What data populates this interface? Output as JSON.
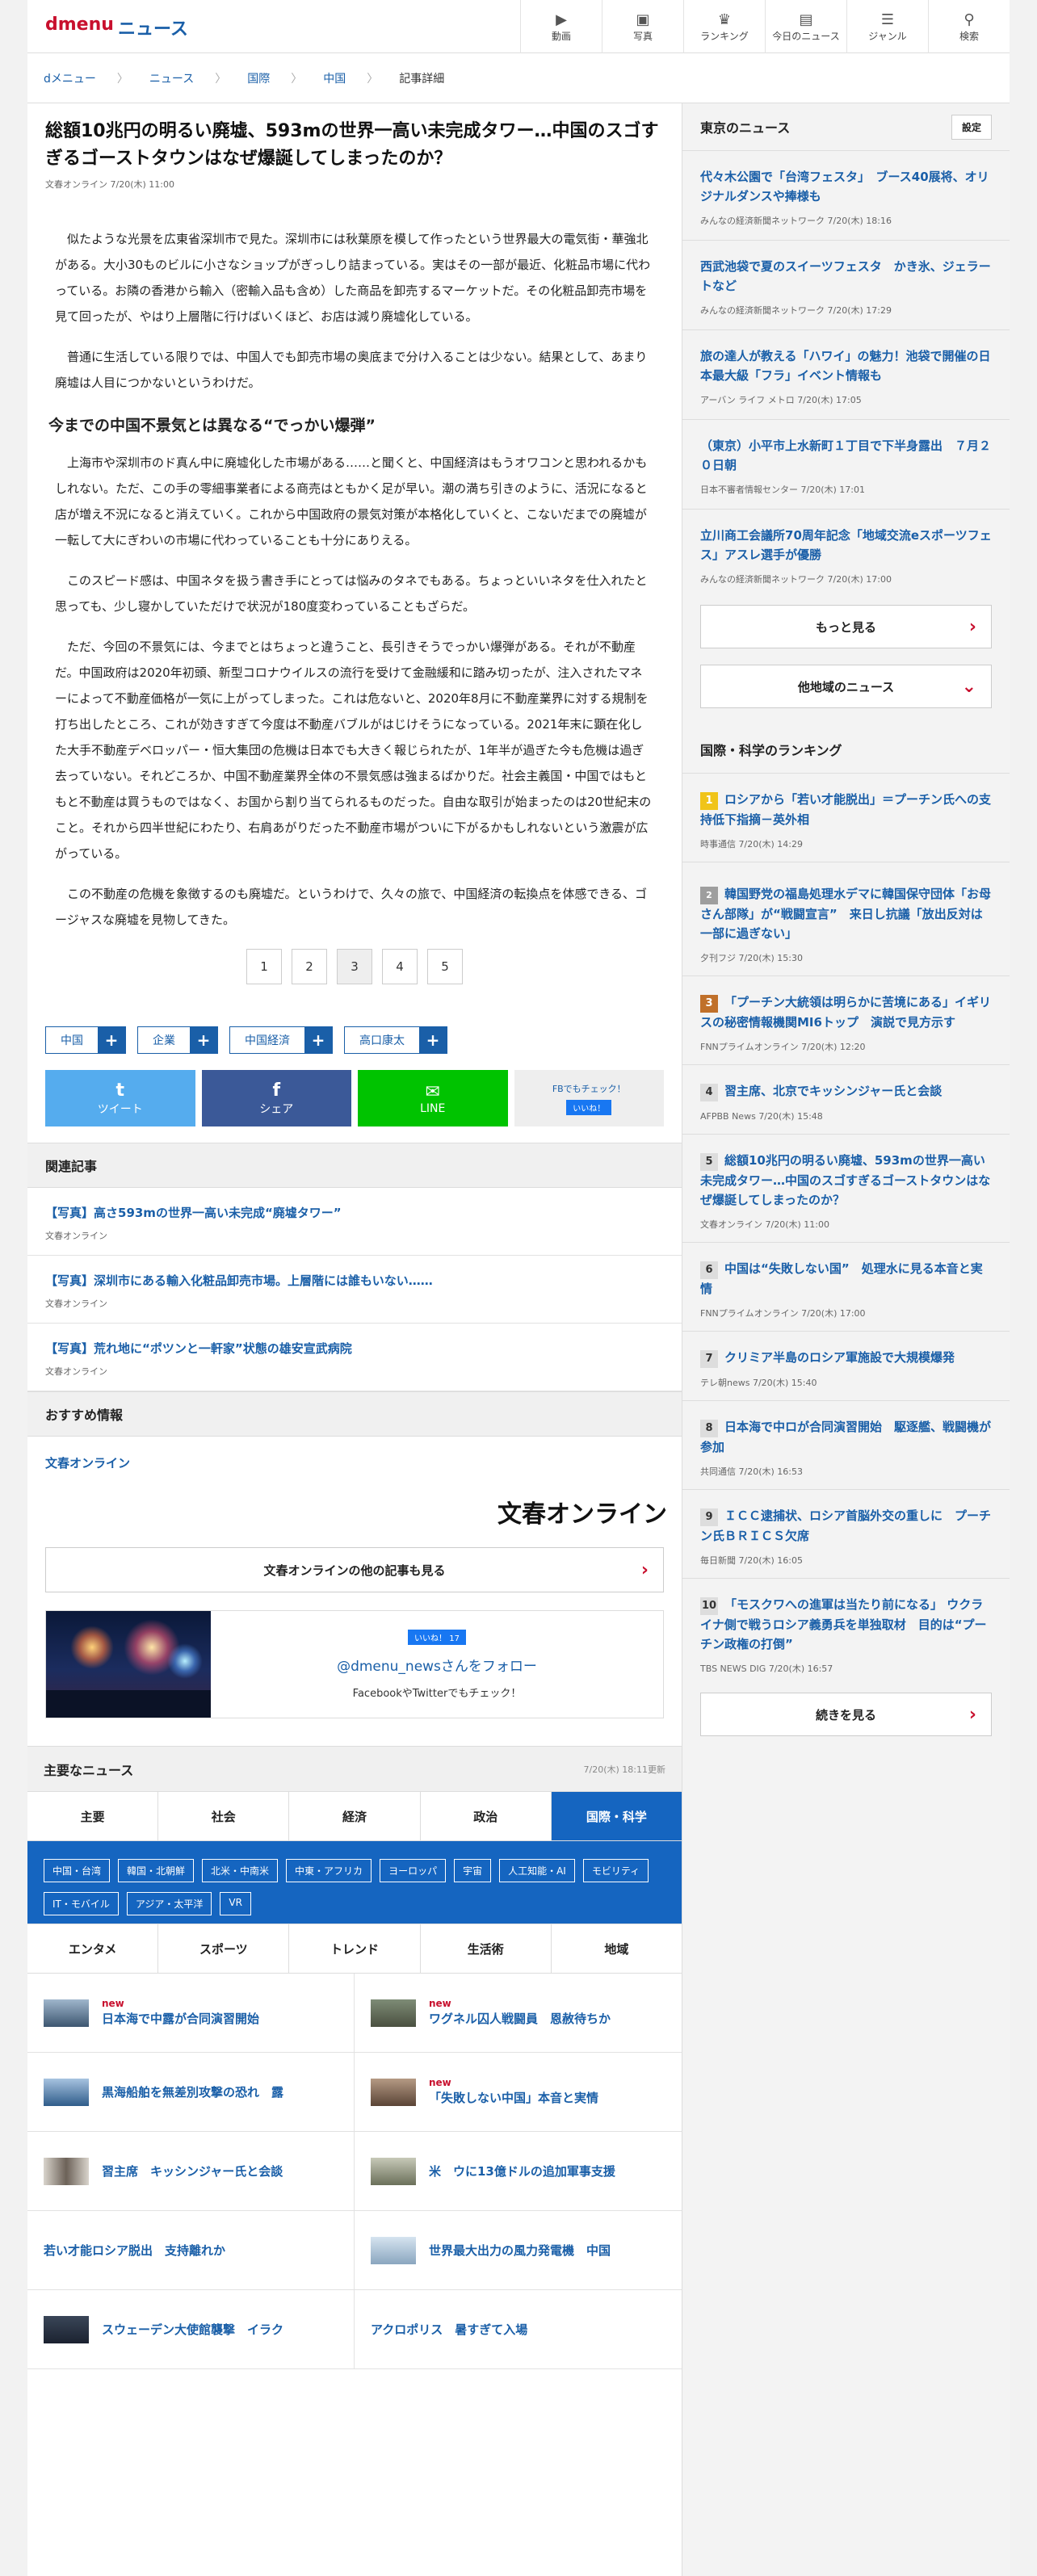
{
  "header": {
    "logo": "dmenu",
    "site_name": "ニュース",
    "nav": [
      {
        "label": "動画",
        "icon": "video-icon"
      },
      {
        "label": "写真",
        "icon": "photo-icon"
      },
      {
        "label": "ランキング",
        "icon": "ranking-icon"
      },
      {
        "label": "今日のニュース",
        "icon": "today-icon"
      },
      {
        "label": "ジャンル",
        "icon": "genre-icon"
      },
      {
        "label": "検索",
        "icon": "search-icon"
      }
    ]
  },
  "breadcrumb": [
    "dメニュー",
    "ニュース",
    "国際",
    "中国",
    "記事詳細"
  ],
  "article": {
    "title": "総額10兆円の明るい廃墟、593mの世界一高い未完成タワー…中国のスゴすぎるゴーストタウンはなぜ爆誕してしまったのか？",
    "source": "文春オンライン",
    "date": "7/20(木) 11:00",
    "p1": "似たような光景を広東省深圳市で見た。深圳市には秋葉原を模して作ったという世界最大の電気街・華強北がある。大小30ものビルに小さなショップがぎっしり詰まっている。実はその一部が最近、化粧品市場に代わっている。お隣の香港から輸入（密輸入品も含め）した商品を卸売するマーケットだ。その化粧品卸売市場を見て回ったが、やはり上層階に行けばいくほど、お店は減り廃墟化している。",
    "p2": "普通に生活している限りでは、中国人でも卸売市場の奥底まで分け入ることは少ない。結果として、あまり廃墟は人目につかないというわけだ。",
    "h2": "今までの中国不景気とは異なる“でっかい爆弾”",
    "p3": "上海市や深圳市のド真ん中に廃墟化した市場がある……と聞くと、中国経済はもうオワコンと思われるかもしれない。ただ、この手の零細事業者による商売はともかく足が早い。潮の満ち引きのように、活況になると店が増え不況になると消えていく。これから中国政府の景気対策が本格化していくと、こないだまでの廃墟が一転して大にぎわいの市場に代わっていることも十分にありえる。",
    "p4": "このスピード感は、中国ネタを扱う書き手にとっては悩みのタネでもある。ちょっといいネタを仕入れたと思っても、少し寝かしていただけで状況が180度変わっていることもざらだ。",
    "p5": "ただ、今回の不景気には、今までとはちょっと違うこと、長引きそうでっかい爆弾がある。それが不動産だ。中国政府は2020年初頭、新型コロナウイルスの流行を受けて金融緩和に踏み切ったが、注入されたマネーによって不動産価格が一気に上がってしまった。これは危ないと、2020年8月に不動産業界に対する規制を打ち出したところ、これが効きすぎて今度は不動産バブルがはじけそうになっている。2021年末に顕在化した大手不動産デベロッパー・恒大集団の危機は日本でも大きく報じられたが、1年半が過ぎた今も危機は過ぎ去っていない。それどころか、中国不動産業界全体の不景気感は強まるばかりだ。社会主義国・中国ではもともと不動産は買うものではなく、お国から割り当てられるものだった。自由な取引が始まったのは20世紀末のこと。それから四半世紀にわたり、右肩あがりだった不動産市場がついに下がるかもしれないという激震が広がっている。",
    "p6": "この不動産の危機を象徴するのも廃墟だ。というわけで、久々の旅で、中国経済の転換点を体感できる、ゴージャスな廃墟を見物してきた。",
    "pages": [
      "1",
      "2",
      "3",
      "4",
      "5"
    ]
  },
  "tags": [
    "中国",
    "企業",
    "中国経済",
    "高口康太"
  ],
  "share": {
    "twitter": "ツイート",
    "facebook": "シェア",
    "line": "LINE",
    "fb_check": "FBでもチェック！",
    "fb_like": "いいね！"
  },
  "related": {
    "heading": "関連記事",
    "items": [
      {
        "title": "【写真】高さ593mの世界一高い未完成“廃墟タワー”",
        "source": "文春オンライン"
      },
      {
        "title": "【写真】深圳市にある輸入化粧品卸売市場。上層階には誰もいない……",
        "source": "文春オンライン"
      },
      {
        "title": "【写真】荒れ地に“ポツンと一軒家”状態の雄安宣武病院",
        "source": "文春オンライン"
      }
    ]
  },
  "recommend": {
    "heading": "おすすめ情報",
    "link": "文春オンライン",
    "logo_text": "文春オンライン",
    "more": "文春オンラインの他の記事も見る",
    "fb_badge": "いいね！ 17",
    "follow": "@dmenu_newsさんをフォロー",
    "follow_sub": "FacebookやTwitterでもチェック！"
  },
  "main_news": {
    "heading": "主要なニュース",
    "updated": "7/20(木) 18:11更新",
    "tabs1": [
      "主要",
      "社会",
      "経済",
      "政治",
      "国際・科学"
    ],
    "subcats": [
      "中国・台湾",
      "韓国・北朝鮮",
      "北米・中南米",
      "中東・アフリカ",
      "ヨーロッパ",
      "宇宙",
      "人工知能・AI",
      "モビリティ",
      "IT・モバイル",
      "アジア・太平洋",
      "VR"
    ],
    "tabs2": [
      "エンタメ",
      "スポーツ",
      "トレンド",
      "生活術",
      "地域"
    ],
    "new_label": "new",
    "items": [
      {
        "title": "日本海で中露が合同演習開始",
        "new": true
      },
      {
        "title": "ワグネル囚人戦闘員　恩赦待ちか",
        "new": true
      },
      {
        "title": "黒海船舶を無差別攻撃の恐れ　露",
        "new": false
      },
      {
        "title": "「失敗しない中国」本音と実情",
        "new": true
      },
      {
        "title": "習主席　キッシンジャー氏と会談",
        "new": false
      },
      {
        "title": "米　ウに13億ドルの追加軍事支援",
        "new": false
      },
      {
        "title": "若い才能ロシア脱出　支持離れか",
        "new": false
      },
      {
        "title": "世界最大出力の風力発電機　中国",
        "new": false
      },
      {
        "title": "スウェーデン大使館襲撃　イラク",
        "new": false
      },
      {
        "title": "アクロポリス　暑すぎて入場",
        "new": false
      }
    ]
  },
  "sidebar": {
    "tokyo": {
      "heading": "東京のニュース",
      "settings": "設定",
      "items": [
        {
          "title": "代々木公園で「台湾フェスタ」　ブース40展将、オリジナルダンスや捧様も",
          "source": "みんなの経済新聞ネットワーク",
          "date": "7/20(木) 18:16"
        },
        {
          "title": "西武池袋で夏のスイーツフェスタ　かき氷、ジェラートなど",
          "source": "みんなの経済新聞ネットワーク",
          "date": "7/20(木) 17:29"
        },
        {
          "title": "旅の達人が教える「ハワイ」の魅力！池袋で開催の日本最大級「フラ」イベント情報も",
          "source": "アーバン ライフ メトロ",
          "date": "7/20(木) 17:05"
        },
        {
          "title": "（東京）小平市上水新町１丁目で下半身露出　７月２０日朝",
          "source": "日本不審者情報センター",
          "date": "7/20(木) 17:01"
        },
        {
          "title": "立川商工会議所70周年記念「地域交流eスポーツフェス」アスレ選手が優勝",
          "source": "みんなの経済新聞ネットワーク",
          "date": "7/20(木) 17:00"
        }
      ],
      "more": "もっと見る",
      "other": "他地域のニュース"
    },
    "ranking": {
      "heading": "国際・科学のランキング",
      "items": [
        {
          "rank": "1",
          "title": "ロシアから「若い才能脱出」＝プーチン氏への支持低下指摘－英外相",
          "source": "時事通信",
          "date": "7/20(木) 14:29"
        },
        {
          "rank": "2",
          "title": "韓国野党の福島処理水デマに韓国保守団体「お母さん部隊」が“戦闘宣言”　来日し抗議「放出反対は一部に過ぎない」",
          "source": "夕刊フジ",
          "date": "7/20(木) 15:30"
        },
        {
          "rank": "3",
          "title": "「プーチン大統領は明らかに苦境にある」イギリスの秘密情報機関MI6トップ　演説で見方示す",
          "source": "FNNプライムオンライン",
          "date": "7/20(木) 12:20"
        },
        {
          "rank": "4",
          "title": "習主席、北京でキッシンジャー氏と会談",
          "source": "AFPBB News",
          "date": "7/20(木) 15:48"
        },
        {
          "rank": "5",
          "title": "総額10兆円の明るい廃墟、593mの世界一高い未完成タワー…中国のスゴすぎるゴーストタウンはなぜ爆誕してしまったのか？",
          "source": "文春オンライン",
          "date": "7/20(木) 11:00"
        },
        {
          "rank": "6",
          "title": "中国は“失敗しない国”　処理水に見る本音と実情",
          "source": "FNNプライムオンライン",
          "date": "7/20(木) 17:00"
        },
        {
          "rank": "7",
          "title": "クリミア半島のロシア軍施設で大規模爆発",
          "source": "テレ朝news",
          "date": "7/20(木) 15:40"
        },
        {
          "rank": "8",
          "title": "日本海で中ロが合同演習開始　駆逐艦、戦闘機が参加",
          "source": "共同通信",
          "date": "7/20(木) 16:53"
        },
        {
          "rank": "9",
          "title": "ＩＣＣ逮捕状、ロシア首脳外交の重しに　プーチン氏ＢＲＩＣＳ欠席",
          "source": "毎日新聞",
          "date": "7/20(木) 16:05"
        },
        {
          "rank": "10",
          "title": "「モスクワへの進軍は当たり前になる」 ウクライナ側で戦うロシア義勇兵を単独取材　目的は“プーチン政権の打倒”",
          "source": "TBS NEWS DIG",
          "date": "7/20(木) 16:57"
        }
      ],
      "more": "続きを見る"
    }
  },
  "colors": {
    "brand_red": "#c8102e",
    "link_blue": "#1a5fa8",
    "tab_blue": "#1565c0",
    "twitter": "#55acee",
    "facebook": "#3b5998",
    "line": "#00c300"
  }
}
